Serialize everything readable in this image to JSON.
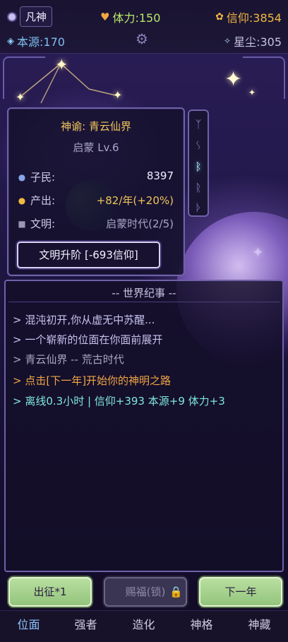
{
  "header": {
    "rank": "凡神",
    "stamina": "体力:150",
    "faith": "信仰:3854",
    "source": "本源:170",
    "stardust": "星尘:305"
  },
  "oracle": {
    "title": "神谕: 青云仙界",
    "level": "启蒙 Lv.6",
    "population_label": "子民:",
    "population_value": "8397",
    "output_label": "产出:",
    "output_value": "+82/年(+20%)",
    "civ_label": "文明:",
    "civ_value": "启蒙时代(2/5)",
    "upgrade_button": "文明升阶 [-693信仰]"
  },
  "runes": [
    "ᛉ",
    "ᛊ",
    "ᛒ",
    "ᚱ",
    "ᚦ"
  ],
  "chronicle": {
    "header": "-- 世界纪事 --",
    "entries": [
      "> 混沌初开,你从虚无中苏醒...",
      "> 一个崭新的位面在你面前展开",
      "> 青云仙界 -- 荒古时代",
      "> 点击[下一年]开始你的神明之路",
      "> 离线0.3小时 | 信仰+393 本源+9 体力+3"
    ]
  },
  "actions": {
    "expedition": "出征*1",
    "bless": "赐福(锁)",
    "next_year": "下一年"
  },
  "nav": {
    "tabs": [
      "位面",
      "强者",
      "造化",
      "神格",
      "神藏"
    ]
  },
  "colors": {
    "accent_green": "#b9e86a",
    "gold": "#f0b941",
    "blue": "#7fbff0",
    "active_tab": "#8fc5ff",
    "log_orange": "#f0a545",
    "log_cyan": "#7fe6e0"
  }
}
